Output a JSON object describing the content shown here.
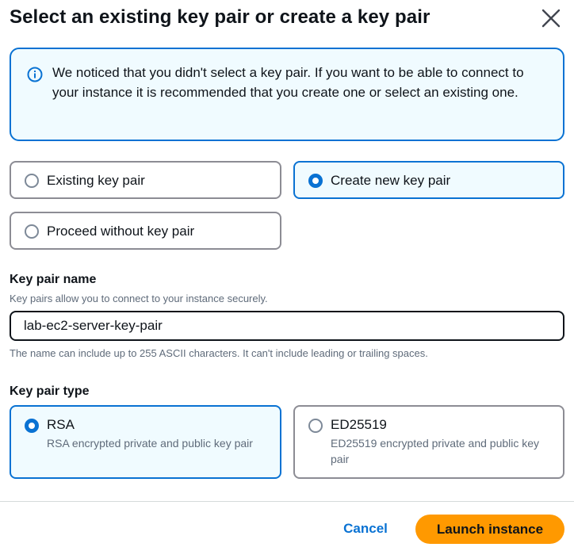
{
  "modal": {
    "title": "Select an existing key pair or create a key pair"
  },
  "alert": {
    "message": "We noticed that you didn't select a key pair. If you want to be able to connect to your instance it is recommended that you create one or select an existing one."
  },
  "key_pair_options": [
    {
      "label": "Existing key pair",
      "selected": false
    },
    {
      "label": "Create new key pair",
      "selected": true
    },
    {
      "label": "Proceed without key pair",
      "selected": false
    }
  ],
  "key_pair_name": {
    "label": "Key pair name",
    "description": "Key pairs allow you to connect to your instance securely.",
    "value": "lab-ec2-server-key-pair",
    "constraint": "The name can include up to 255 ASCII characters. It can't include leading or trailing spaces."
  },
  "key_pair_type": {
    "label": "Key pair type",
    "options": [
      {
        "label": "RSA",
        "description": "RSA encrypted private and public key pair",
        "selected": true
      },
      {
        "label": "ED25519",
        "description": "ED25519 encrypted private and public key pair",
        "selected": false
      }
    ]
  },
  "footer": {
    "cancel_label": "Cancel",
    "launch_label": "Launch instance"
  },
  "colors": {
    "accent": "#0972d3",
    "primary_button": "#ff9900",
    "selected_tile_bg": "#f0fbff"
  },
  "icons": {
    "close": "close-icon",
    "info": "info-icon"
  }
}
